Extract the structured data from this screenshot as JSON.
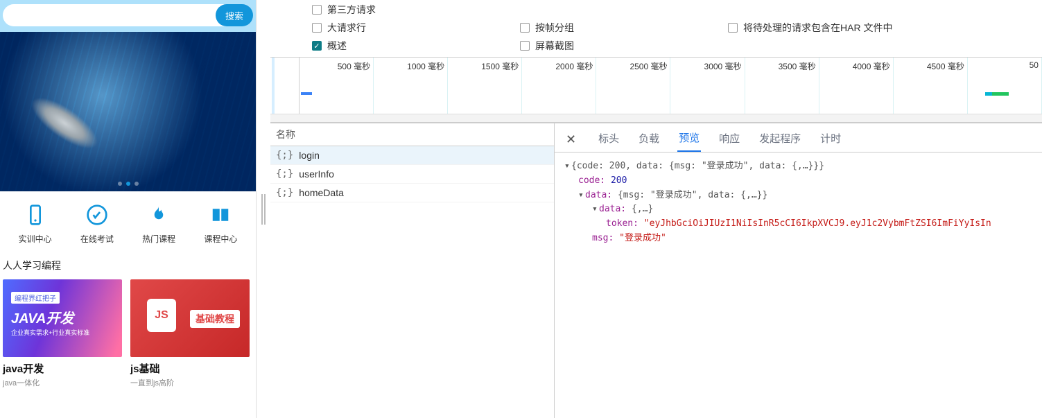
{
  "mobile": {
    "search_placeholder": "",
    "search_button": "搜索",
    "nav": [
      {
        "icon": "phone",
        "label": "实训中心"
      },
      {
        "icon": "exam",
        "label": "在线考试"
      },
      {
        "icon": "fire",
        "label": "热门课程"
      },
      {
        "icon": "book",
        "label": "课程中心"
      }
    ],
    "section_title": "人人学习编程",
    "cards": [
      {
        "kind": "java",
        "badge": "编程界红把子",
        "img_title": "JAVA开发",
        "img_sub": "企业真实需求+行业真实标准",
        "title": "java开发",
        "subtitle": "java一体化"
      },
      {
        "kind": "js",
        "shield": "JS",
        "img_badge": "基础教程",
        "title": "js基础",
        "subtitle": "一直到js高阶"
      }
    ]
  },
  "devtools": {
    "filters": {
      "third_party": "第三方请求",
      "large_rows": "大请求行",
      "group_by_frame": "按帧分组",
      "include_har": "将待处理的请求包含在HAR 文件中",
      "overview": "概述",
      "screenshots": "屏幕截图"
    },
    "timeline_ticks": [
      "500 毫秒",
      "1000 毫秒",
      "1500 毫秒",
      "2000 毫秒",
      "2500 毫秒",
      "3000 毫秒",
      "3500 毫秒",
      "4000 毫秒",
      "4500 毫秒",
      "50"
    ],
    "req_header": "名称",
    "requests": [
      "login",
      "userInfo",
      "homeData"
    ],
    "tabs": [
      "标头",
      "负载",
      "预览",
      "响应",
      "发起程序",
      "计时"
    ],
    "active_tab": "预览",
    "preview": {
      "summary": "{code: 200, data: {msg: \"登录成功\", data: {,…}}}",
      "code_key": "code:",
      "code_val": "200",
      "data_key": "data:",
      "data_summary": "{msg: \"登录成功\", data: {,…}}",
      "inner_data_key": "data:",
      "inner_data_summary": "{,…}",
      "token_key": "token:",
      "token_val": "\"eyJhbGciOiJIUzI1NiIsInR5cCI6IkpXVCJ9.eyJ1c2VybmFtZSI6ImFiYyIsIn",
      "msg_key": "msg:",
      "msg_val": "\"登录成功\""
    }
  }
}
